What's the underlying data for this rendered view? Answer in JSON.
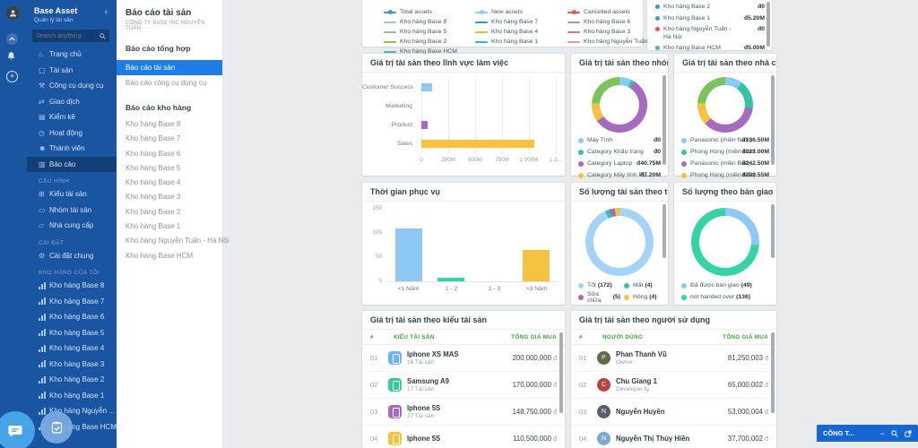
{
  "app": {
    "name": "Base Asset",
    "subtitle": "Quản lý tài sản",
    "search_placeholder": "Search anything"
  },
  "nav": {
    "main": [
      {
        "glyph": "⌂",
        "label": "Trang chủ",
        "bg": "transparent"
      },
      {
        "glyph": "▢",
        "label": "Tài sản",
        "bg": "transparent"
      },
      {
        "glyph": "⚒",
        "label": "Công cụ dụng cụ",
        "bg": "transparent"
      },
      {
        "glyph": "⇄",
        "label": "Giao dịch",
        "bg": "transparent"
      },
      {
        "glyph": "▤",
        "label": "Kiểm kê",
        "bg": "transparent"
      },
      {
        "glyph": "◷",
        "label": "Hoạt động",
        "bg": "transparent"
      },
      {
        "glyph": "☻",
        "label": "Thành viên",
        "bg": "transparent"
      },
      {
        "glyph": "▥",
        "label": "Báo cáo",
        "bg": "rgba(0,0,0,0.25)"
      }
    ],
    "config_label": "CẤU HÌNH",
    "config": [
      {
        "glyph": "⊞",
        "label": "Kiểu tài sản"
      },
      {
        "glyph": "▭",
        "label": "Nhóm tài sản"
      },
      {
        "glyph": "▱",
        "label": "Nhà cung cấp"
      }
    ],
    "settings_label": "CÀI ĐẶT",
    "settings": [
      {
        "glyph": "⚙",
        "label": "Cài đặt chung"
      }
    ],
    "my_warehouses_label": "KHO HÀNG CỦA TÔI",
    "my_warehouses": [
      {
        "label": "Kho hàng Base 8"
      },
      {
        "label": "Kho hàng Base 7"
      },
      {
        "label": "Kho hàng Base 6"
      },
      {
        "label": "Kho hàng Base 5"
      },
      {
        "label": "Kho hàng Base 4"
      },
      {
        "label": "Kho hàng Base 3"
      },
      {
        "label": "Kho hàng Base 2"
      },
      {
        "label": "Kho hàng Base 1"
      },
      {
        "label": "Kho hàng Nguyễn ..."
      },
      {
        "label": "Kho hàng Base HCM"
      }
    ]
  },
  "panel": {
    "title": "Báo cáo tài sản",
    "company": "CÔNG TY BASE INC NGUYỄN TUẤN",
    "group1_heading": "Báo cáo tổng hợp",
    "active_report": "Báo cáo tài sản",
    "secondary_report": "Báo cáo công cụ dụng cụ",
    "group2_heading": "Báo cáo kho hàng",
    "warehouses": [
      {
        "label": "Kho hàng Base 8"
      },
      {
        "label": "Kho hàng Base 7"
      },
      {
        "label": "Kho hàng Base 6"
      },
      {
        "label": "Kho hàng Base 5"
      },
      {
        "label": "Kho hàng Base 4"
      },
      {
        "label": "Kho hàng Base 3"
      },
      {
        "label": "Kho hàng Base 2"
      },
      {
        "label": "Kho hàng Base 1"
      },
      {
        "label": "Kho hàng Nguyễn Tuấn - Hà Nội"
      },
      {
        "label": "Kho hàng Base HCM"
      }
    ]
  },
  "chart_data": {
    "asset_timeline": {
      "type": "line",
      "colA_head": {
        "label": "Total assets",
        "color": "#4a90d9"
      },
      "colA": [
        {
          "label": "Kho hàng Base 8",
          "color": "#b0bec5"
        },
        {
          "label": "Kho hàng Base 5",
          "color": "#9fb8ad"
        },
        {
          "label": "Kho hàng Base 2",
          "color": "#8bc34a"
        },
        {
          "label": "Kho hàng Base HCM",
          "color": "#4db6ac"
        }
      ],
      "colB_head": {
        "label": "New assets",
        "color": "#90caf9"
      },
      "colB": [
        {
          "label": "Kho hàng Base 7",
          "color": "#26a69a"
        },
        {
          "label": "Kho hàng Base 4",
          "color": "#c0ca33"
        },
        {
          "label": "Kho hàng Base 1",
          "color": "#42a5f5"
        }
      ],
      "colC_head": {
        "label": "Cancelled assets",
        "color": "#ef5350"
      },
      "colC": [
        {
          "label": "Kho hàng Base 6",
          "color": "#9e9e9e"
        },
        {
          "label": "Kho hàng Base 3",
          "color": "#e57373"
        },
        {
          "label": "Kho hàng Nguyễn Tuấn - Hà Nội",
          "color": "#f48fb1"
        }
      ]
    },
    "warehouse_values": {
      "type": "list",
      "items": [
        {
          "label": "Kho hàng Base 2",
          "value": "đ0",
          "color": "#4a90d9"
        },
        {
          "label": "Kho hàng Base 1",
          "value": "đ5.20M",
          "color": "#4a90d9"
        },
        {
          "label": "Kho hàng Nguyễn Tuấn - Hà Nội",
          "value": "đ0",
          "color": "#ef5350"
        },
        {
          "label": "Kho hàng Base HCM",
          "value": "đ5.00M",
          "color": "#4db6ac"
        }
      ]
    },
    "field_value": {
      "type": "bar",
      "horizontal": true,
      "title": "Giá trị tài sản theo lĩnh vực làm việc",
      "xmax": "1250M",
      "bars": [
        {
          "label": "Customer Success",
          "value": "100M",
          "pct": 8,
          "color": "#8ec9f5"
        },
        {
          "label": "Marketing",
          "value": "0",
          "pct": 0,
          "color": "#8ec9f5"
        },
        {
          "label": "Product",
          "value": "60M",
          "pct": 4.8,
          "color": "#a66bbf"
        },
        {
          "label": "Sales",
          "value": "1050M",
          "pct": 84,
          "color": "#f7c33e"
        }
      ],
      "xticks": [
        {
          "label": "0",
          "pct": 0
        },
        {
          "label": "250M",
          "pct": 20
        },
        {
          "label": "500M",
          "pct": 40
        },
        {
          "label": "750M",
          "pct": 60
        },
        {
          "label": "1 000M",
          "pct": 80
        },
        {
          "label": "1 2...",
          "pct": 100
        }
      ]
    },
    "group_value": {
      "type": "donut",
      "title": "Giá trị tài sản theo nhóm",
      "segments": [
        {
          "color": "#8ec9f5",
          "pct": 7
        },
        {
          "color": "#35c4a4",
          "pct": 2
        },
        {
          "color": "#a66bbf",
          "pct": 56
        },
        {
          "color": "#f7c33e",
          "pct": 11
        },
        {
          "color": "#7cc35b",
          "pct": 24
        }
      ],
      "legend": [
        {
          "label": "Máy Tính",
          "value": "đ0",
          "color": "#8ec9f5"
        },
        {
          "label": "Category Khẩu trang",
          "value": "đ0",
          "color": "#35c4a4"
        },
        {
          "label": "Category Laptop",
          "value": "đ40.75M",
          "color": "#a66bbf"
        },
        {
          "label": "Category Máy tính PC",
          "value": "đ7.20M",
          "color": "#f7c33e"
        }
      ]
    },
    "supplier_value": {
      "type": "donut",
      "title": "Giá trị tài sản theo nhà cung cấp",
      "segments": [
        {
          "color": "#8ec9f5",
          "pct": 10
        },
        {
          "color": "#35c4a4",
          "pct": 17
        },
        {
          "color": "#a66bbf",
          "pct": 36
        },
        {
          "color": "#f7c33e",
          "pct": 13
        },
        {
          "color": "#7cc35b",
          "pct": 24
        }
      ],
      "legend": [
        {
          "label": "Panasonic (miền Nam)",
          "value": "đ136.50M",
          "color": "#8ec9f5"
        },
        {
          "label": "Phong Hùng (miền Nam)",
          "value": "đ223.00M",
          "color": "#35c4a4"
        },
        {
          "label": "Panasonic (miền Bắc)",
          "value": "đ242.50M",
          "color": "#a66bbf"
        },
        {
          "label": "Phong Hùng (miền Bắc)",
          "value": "đ209.55M",
          "color": "#f7c33e"
        }
      ]
    },
    "service_time": {
      "type": "bar",
      "title": "Thời gian phục vụ",
      "ymax": 150,
      "yticks": [
        "150",
        "100",
        "50",
        "0"
      ],
      "bars": [
        {
          "label": "<1 Năm",
          "value": 110,
          "pct": 73.3,
          "color": "#8ec9f5"
        },
        {
          "label": "1 - 2",
          "value": 8,
          "pct": 5.3,
          "color": "#35d3a5"
        },
        {
          "label": "2 - 3",
          "value": 0,
          "pct": 0,
          "color": "#35d3a5"
        },
        {
          "label": ">3 Năm",
          "value": 65,
          "pct": 43.3,
          "color": "#f7c33e"
        }
      ]
    },
    "status_count": {
      "type": "donut",
      "title": "Số lượng tài sản theo trạng thái",
      "segments": [
        {
          "color": "#a5d3f7",
          "pct": 93
        },
        {
          "color": "#35c4a4",
          "pct": 2.2
        },
        {
          "color": "#a66bbf",
          "pct": 2.6
        },
        {
          "color": "#f7c33e",
          "pct": 2.2
        }
      ],
      "legend": [
        {
          "label": "Tốt",
          "count": "(172)",
          "color": "#a5d3f7"
        },
        {
          "label": "Mất",
          "count": "(4)",
          "color": "#35c4a4"
        },
        {
          "label": "Sửa chữa",
          "count": "(5)",
          "color": "#a66bbf"
        },
        {
          "label": "Hỏng",
          "count": "(4)",
          "color": "#f7c33e"
        }
      ]
    },
    "handover_count": {
      "type": "donut",
      "title": "Số lượng theo bàn giao",
      "segments": [
        {
          "color": "#8ec9f5",
          "pct": 26.5
        },
        {
          "color": "#35d3a5",
          "pct": 73.5
        }
      ],
      "legend": [
        {
          "label": "Đã được bàn giao",
          "count": "(49)",
          "color": "#8ec9f5"
        },
        {
          "label": "not handed over",
          "count": "(136)",
          "color": "#35d3a5"
        }
      ]
    }
  },
  "tables": {
    "currency": "đ",
    "asset_type": {
      "title": "Giá trị tài sản theo kiểu tài sản",
      "headers": {
        "num": "#",
        "name": "KIỂU TÀI SẢN",
        "value": "TỔNG GIÁ MUA"
      },
      "rows": [
        {
          "num": "01",
          "name": "Iphone XS MAS",
          "count": "16 Tài sản",
          "value": "200,000,000",
          "icon": "#6fb3f2"
        },
        {
          "num": "02",
          "name": "Samsung A9",
          "count": "17 Tài sản",
          "value": "170,000,000",
          "icon": "#35cc96"
        },
        {
          "num": "03",
          "name": "Iphone 5S",
          "count": "17 Tài sản",
          "value": "148,750,000",
          "icon": "#a66bbf"
        },
        {
          "num": "04",
          "name": "Iphone 5S",
          "count": "",
          "value": "110,500,000",
          "icon": "#f7c33e"
        }
      ]
    },
    "user_value": {
      "title": "Giá trị tài sản theo người sử dụng",
      "headers": {
        "num": "#",
        "name": "NGƯỜI DÙNG",
        "value": "TỔNG GIÁ MUA"
      },
      "rows": [
        {
          "num": "01",
          "name": "Phan Thanh Vũ",
          "role": "Owner",
          "value": "81,250,003",
          "avatar": "#5d6b4a",
          "initial": "P"
        },
        {
          "num": "02",
          "name": "Chu Giang 1",
          "role": "Developer fg",
          "value": "65,000,002",
          "avatar": "#b5453e",
          "initial": "C"
        },
        {
          "num": "03",
          "name": "Nguyễn Huyền",
          "role": "",
          "value": "53,000,004",
          "avatar": "#5a5f66",
          "initial": "N"
        },
        {
          "num": "04",
          "name": "Nguyễn Thị Thúy Hiền",
          "role": "",
          "value": "37,700,002",
          "avatar": "#79a9cf",
          "initial": "N"
        }
      ]
    }
  },
  "chat_bar": {
    "label": "CÔNG T..."
  }
}
